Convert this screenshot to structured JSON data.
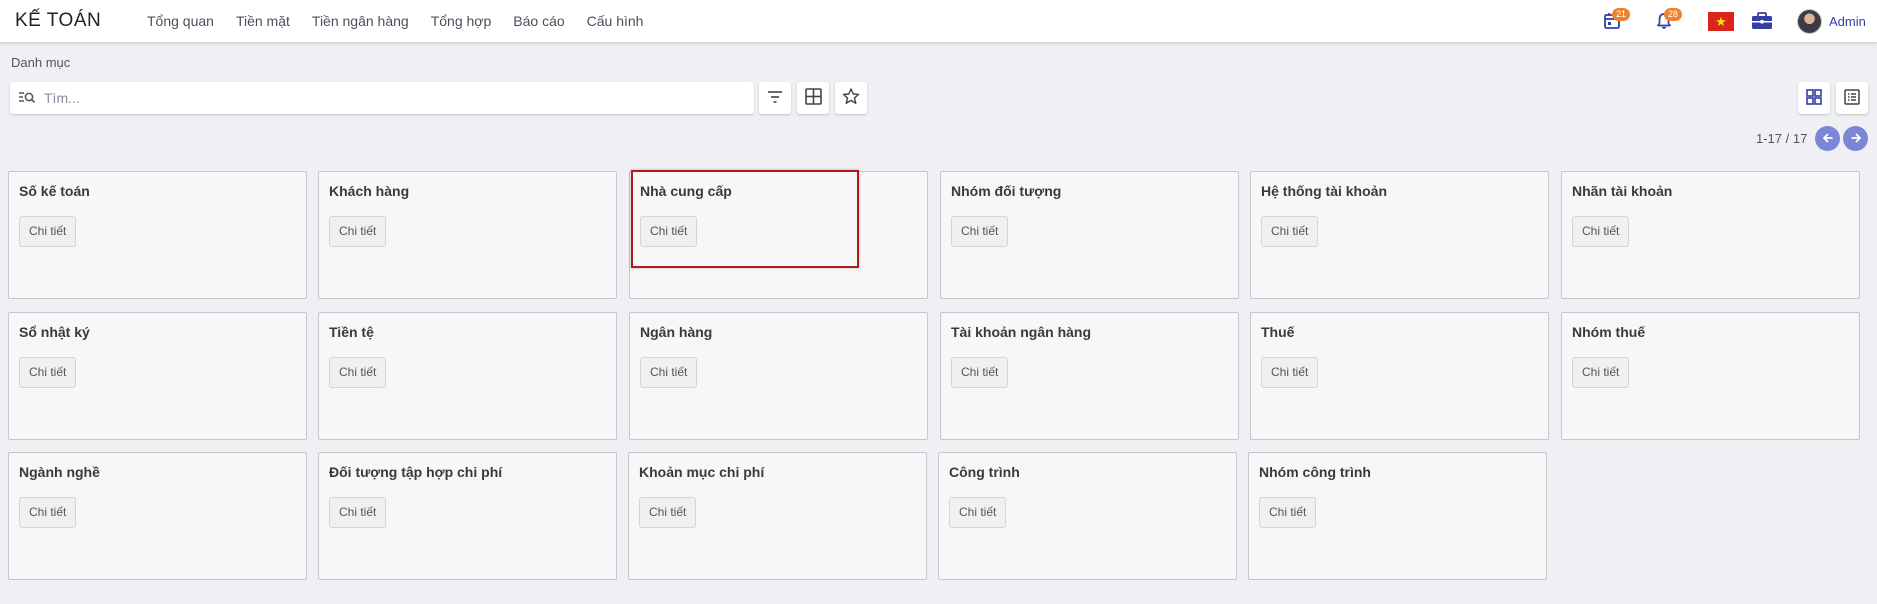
{
  "app": {
    "title": "KẾ TOÁN"
  },
  "nav": [
    "Tổng quan",
    "Tiền mặt",
    "Tiền ngân hàng",
    "Tổng hợp",
    "Báo cáo",
    "Cấu hình"
  ],
  "header_right": {
    "calendar_count": "21",
    "notification_count": "28",
    "user_name": "Admin",
    "icons": [
      "calendar-icon",
      "bell-icon",
      "vietnam-flag-icon",
      "briefcase-icon",
      "avatar"
    ]
  },
  "breadcrumb": "Danh mục",
  "search": {
    "placeholder": "Tìm...",
    "value": ""
  },
  "pager": {
    "text": "1-17 / 17"
  },
  "colors": {
    "accent": "#3340a6",
    "badge": "#f0822d",
    "pager": "#7b86d6",
    "highlight": "#b21a1a"
  },
  "cards": [
    {
      "title": "Số kế toán",
      "button": "Chi tiết"
    },
    {
      "title": "Khách hàng",
      "button": "Chi tiết"
    },
    {
      "title": "Nhà cung cấp",
      "button": "Chi tiết"
    },
    {
      "title": "Nhóm đối tượng",
      "button": "Chi tiết"
    },
    {
      "title": "Hệ thống tài khoản",
      "button": "Chi tiết"
    },
    {
      "title": "Nhãn tài khoản",
      "button": "Chi tiết"
    },
    {
      "title": "Sổ nhật ký",
      "button": "Chi tiết"
    },
    {
      "title": "Tiền tệ",
      "button": "Chi tiết"
    },
    {
      "title": "Ngân hàng",
      "button": "Chi tiết"
    },
    {
      "title": "Tài khoản ngân hàng",
      "button": "Chi tiết"
    },
    {
      "title": "Thuế",
      "button": "Chi tiết"
    },
    {
      "title": "Nhóm thuế",
      "button": "Chi tiết"
    },
    {
      "title": "Ngành nghề",
      "button": "Chi tiết"
    },
    {
      "title": "Đối tượng tập hợp chi phí",
      "button": "Chi tiết"
    },
    {
      "title": "Khoản mục chi phí",
      "button": "Chi tiết"
    },
    {
      "title": "Công trình",
      "button": "Chi tiết"
    },
    {
      "title": "Nhóm công trình",
      "button": "Chi tiết"
    }
  ]
}
